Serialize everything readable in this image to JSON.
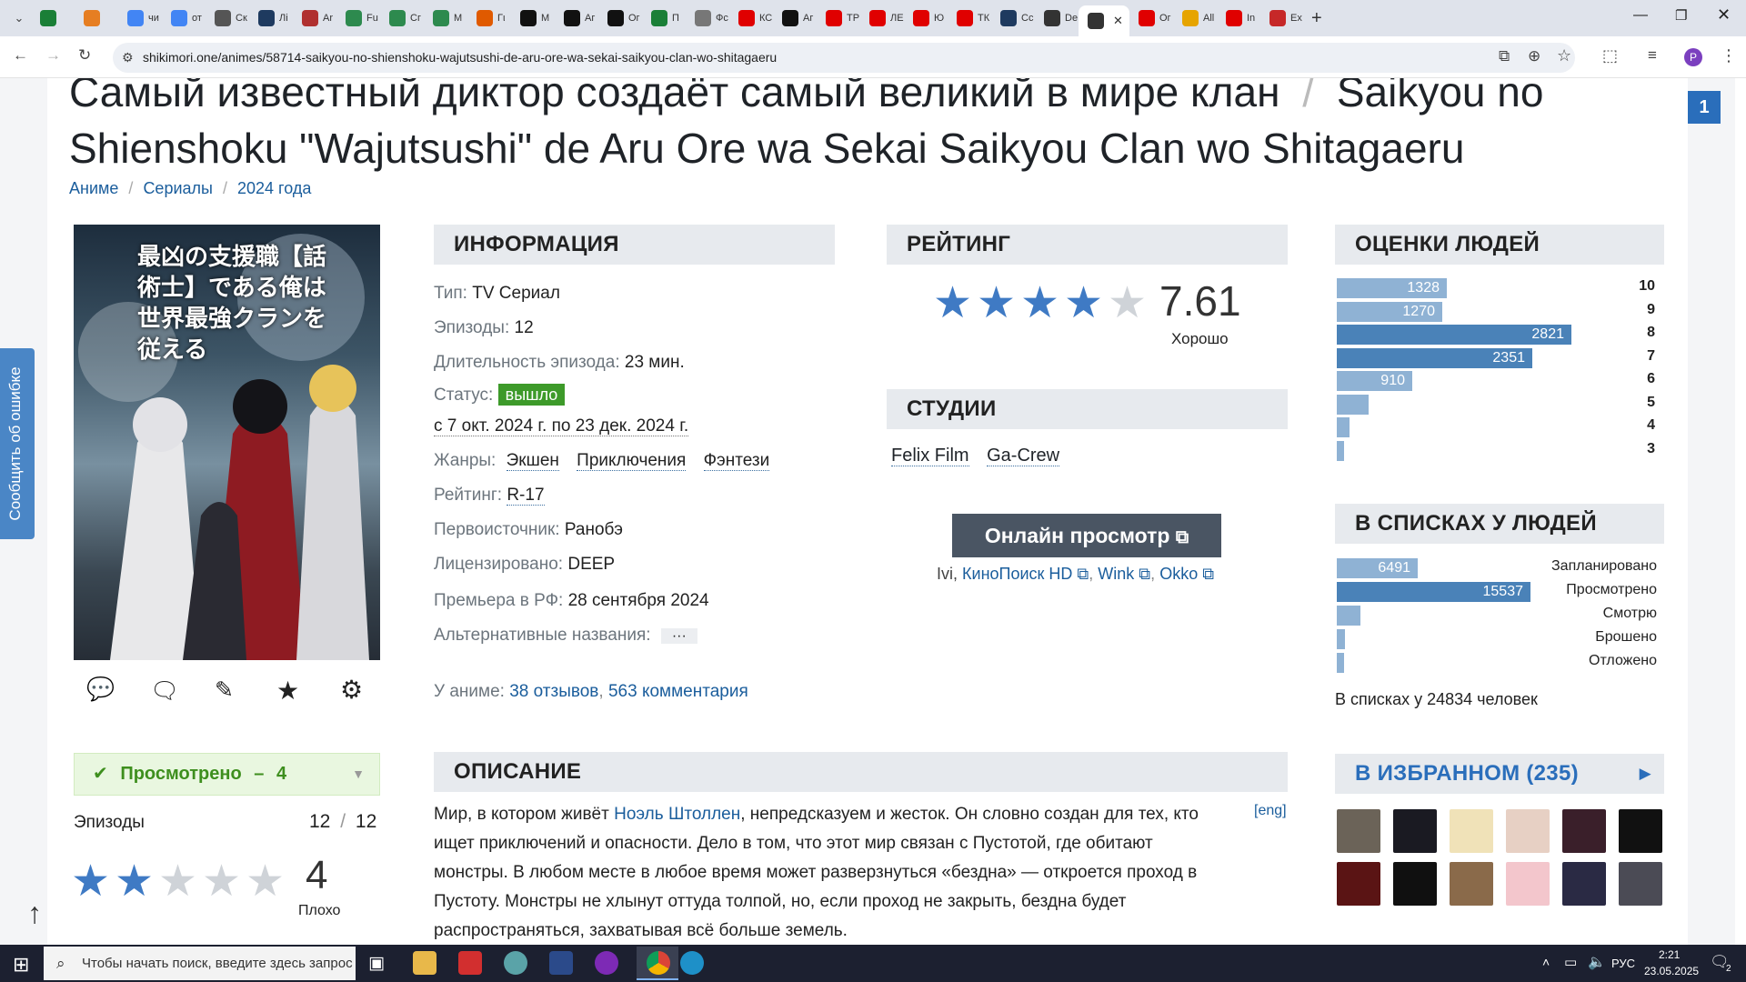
{
  "browser": {
    "tabs": [
      {
        "label": "",
        "color": "#1a7f37"
      },
      {
        "label": "",
        "color": "#e67e22"
      },
      {
        "label": "чи",
        "color": "#4285f4"
      },
      {
        "label": "от",
        "color": "#4285f4"
      },
      {
        "label": "Ск",
        "color": "#555555"
      },
      {
        "label": "Лі",
        "color": "#1e3a5f"
      },
      {
        "label": "Ar",
        "color": "#b03030"
      },
      {
        "label": "Fu",
        "color": "#2d8a4e"
      },
      {
        "label": "Сг",
        "color": "#2d8a4e"
      },
      {
        "label": "М",
        "color": "#2d8a4e"
      },
      {
        "label": "Гι",
        "color": "#e05a00"
      },
      {
        "label": "М",
        "color": "#111111"
      },
      {
        "label": "Аг",
        "color": "#111111"
      },
      {
        "label": "Ог",
        "color": "#111111"
      },
      {
        "label": "П",
        "color": "#1a7f37"
      },
      {
        "label": "Фс",
        "color": "#777777"
      },
      {
        "label": "КС",
        "color": "#e00000"
      },
      {
        "label": "Аг",
        "color": "#111111"
      },
      {
        "label": "ТР",
        "color": "#e00000"
      },
      {
        "label": "ЛЕ",
        "color": "#e00000"
      },
      {
        "label": "Ю",
        "color": "#e00000"
      },
      {
        "label": "ТК",
        "color": "#e00000"
      },
      {
        "label": "Сс",
        "color": "#1e3a5f"
      },
      {
        "label": "De",
        "color": "#333333"
      },
      {
        "label": "",
        "color": "#333333",
        "active": true
      },
      {
        "label": "Ог",
        "color": "#e00000"
      },
      {
        "label": "All",
        "color": "#e6a400"
      },
      {
        "label": "In",
        "color": "#e00000"
      },
      {
        "label": "Ex",
        "color": "#c62828"
      }
    ],
    "url": "shikimori.one/animes/58714-saikyou-no-shienshoku-wajutsushi-de-aru-ore-wa-sekai-saikyou-clan-wo-shitagaeru",
    "profile_letter": "P"
  },
  "page": {
    "title_ru": "Самый известный диктор создаёт самый великий в мире клан",
    "title_sep": "/",
    "title_en_1": "Saikyou no",
    "title_en_2": "Shienshoku \"Wajutsushi\" de Aru Ore wa Sekai Saikyou Clan wo Shitagaeru",
    "breadcrumbs": [
      "Аниме",
      "Сериалы",
      "2024 года"
    ],
    "side_badge": "1",
    "report_label": "Сообщить об ошибке",
    "poster_title_jp": "最凶の支援職【話術士】である俺は世界最強クランを従える",
    "info": {
      "heading": "ИНФОРМАЦИЯ",
      "type_k": "Тип:",
      "type_v": "TV Сериал",
      "episodes_k": "Эпизоды:",
      "episodes_v": "12",
      "duration_k": "Длительность эпизода:",
      "duration_v": "23 мин.",
      "status_k": "Статус:",
      "status_v": "вышло",
      "aired": "с 7 окт. 2024 г. по 23 дек. 2024 г.",
      "genres_k": "Жанры:",
      "genres": [
        "Экшен",
        "Приключения",
        "Фэнтези"
      ],
      "rating_k": "Рейтинг:",
      "rating_v": "R-17",
      "source_k": "Первоисточник:",
      "source_v": "Ранобэ",
      "licensed_k": "Лицензировано:",
      "licensed_v": "DEEP",
      "premiere_k": "Премьера в РФ:",
      "premiere_v": "28 сентября 2024",
      "alt_k": "Альтернативные названия:",
      "alt_v": "···",
      "reviews_k": "У аниме:",
      "reviews_v": "38 отзывов",
      "comments_v": "563 комментария",
      "comma": ","
    },
    "rating": {
      "heading": "РЕЙТИНГ",
      "score": "7.61",
      "score_value": 7.61,
      "stars_filled": 4,
      "label": "Хорошо"
    },
    "studios": {
      "heading": "СТУДИИ",
      "items": [
        "Felix Film",
        "Ga-Crew"
      ]
    },
    "watch": {
      "button": "Онлайн просмотр",
      "prefix": "Ivi,",
      "links": [
        "КиноПоиск HD",
        "Wink",
        "Okko"
      ]
    },
    "user": {
      "status": "Просмотрено",
      "status_dash": "–",
      "status_score": "4",
      "episodes_label": "Эпизоды",
      "episodes_watched": "12",
      "episodes_sep": "/",
      "episodes_total": "12",
      "score": "4",
      "score_stars": 2,
      "score_label": "Плохо"
    },
    "description": {
      "heading": "ОПИСАНИЕ",
      "lang_link": "[eng]",
      "p1a": "Мир, в котором живёт ",
      "p1_link": "Ноэль Штоллен",
      "p1b": ", непредсказуем и жесток. Он словно создан для тех, кто",
      "line2": "ищет приключений и опасности. Дело в том, что этот мир связан с Пустотой, где обитают",
      "line3": "монстры. В любом месте в любое время может разверзнуться «бездна» — откроется проход в",
      "line4": "Пустоту. Монстры не хлынут оттуда толпой, но, если проход не закрыть, бездна будет",
      "line5": "распространяться, захватывая всё больше земель."
    },
    "scores_heading": "ОЦЕНКИ ЛЮДЕЙ",
    "lists_heading": "В СПИСКАХ У ЛЮДЕЙ",
    "lists_total": "В списках у 24834 человек",
    "favorites_heading": "В ИЗБРАННОМ",
    "favorites_count": "235",
    "favorites_colors": [
      "#6b6358",
      "#1a1a22",
      "#f0e2b8",
      "#e7d0c4",
      "#3a1f2a",
      "#111111",
      "#5a1414",
      "#101010",
      "#8a6a4a",
      "#f3c6cc",
      "#2a2a44",
      "#4b4b55"
    ]
  },
  "chart_data": [
    {
      "type": "bar",
      "title": "ОЦЕНКИ ЛЮДЕЙ",
      "categories": [
        "10",
        "9",
        "8",
        "7",
        "6",
        "5",
        "4",
        "3"
      ],
      "values": [
        1328,
        1270,
        2821,
        2351,
        910,
        380,
        150,
        70
      ],
      "labels": [
        "1328",
        "1270",
        "2821",
        "2351",
        "910",
        "",
        "",
        ""
      ]
    },
    {
      "type": "bar",
      "title": "В СПИСКАХ У ЛЮДЕЙ",
      "categories": [
        "Запланировано",
        "Просмотрено",
        "Смотрю",
        "Брошено",
        "Отложено"
      ],
      "values": [
        6491,
        15537,
        1900,
        650,
        250
      ],
      "labels": [
        "6491",
        "15537",
        "",
        "",
        ""
      ]
    }
  ],
  "taskbar": {
    "search_placeholder": "Чтобы начать поиск, введите здесь запрос",
    "lang": "РУС",
    "time": "2:21",
    "date": "23.05.2025",
    "notif_count": "2"
  }
}
